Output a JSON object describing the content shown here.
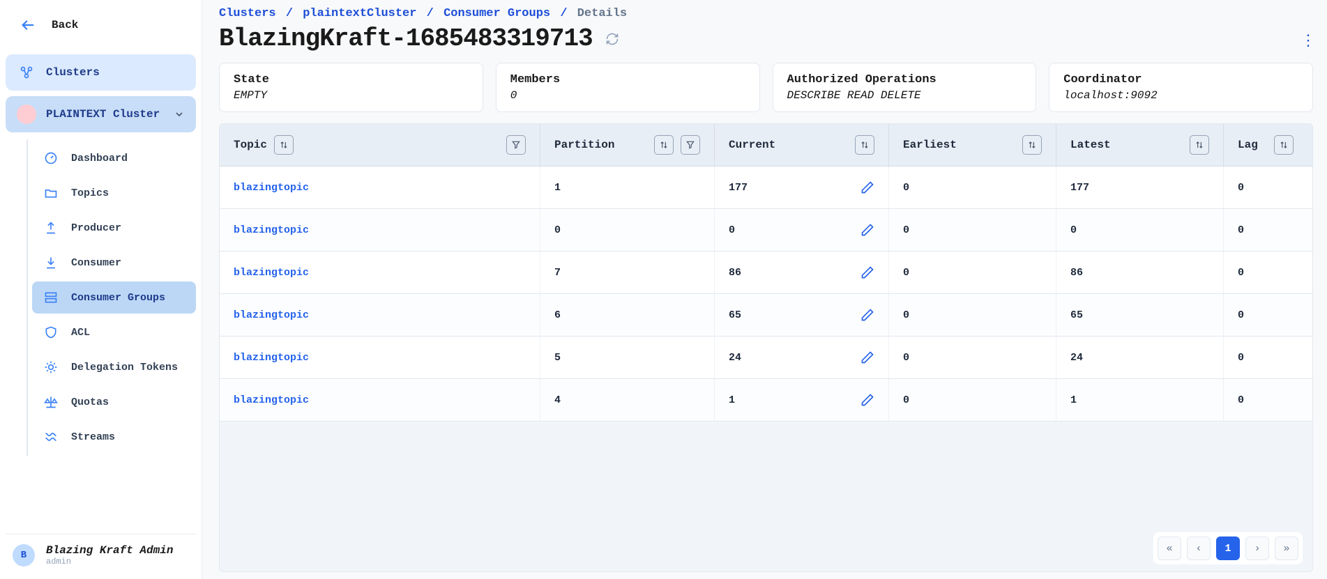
{
  "sidebar": {
    "back": "Back",
    "clusters": "Clusters",
    "current_cluster": "PLAINTEXT Cluster",
    "items": [
      {
        "label": "Dashboard"
      },
      {
        "label": "Topics"
      },
      {
        "label": "Producer"
      },
      {
        "label": "Consumer"
      },
      {
        "label": "Consumer Groups"
      },
      {
        "label": "ACL"
      },
      {
        "label": "Delegation Tokens"
      },
      {
        "label": "Quotas"
      },
      {
        "label": "Streams"
      }
    ],
    "user": {
      "initial": "B",
      "name": "Blazing Kraft Admin",
      "role": "admin"
    }
  },
  "breadcrumb": {
    "parts": [
      "Clusters",
      "plaintextCluster",
      "Consumer Groups",
      "Details"
    ]
  },
  "page_title": "BlazingKraft-1685483319713",
  "cards": [
    {
      "label": "State",
      "value": "EMPTY"
    },
    {
      "label": "Members",
      "value": "0"
    },
    {
      "label": "Authorized Operations",
      "value": "DESCRIBE READ DELETE"
    },
    {
      "label": "Coordinator",
      "value": "localhost:9092"
    }
  ],
  "table": {
    "headers": [
      "Topic",
      "Partition",
      "Current",
      "Earliest",
      "Latest",
      "Lag"
    ],
    "rows": [
      {
        "topic": "blazingtopic",
        "partition": "1",
        "current": "177",
        "earliest": "0",
        "latest": "177",
        "lag": "0"
      },
      {
        "topic": "blazingtopic",
        "partition": "0",
        "current": "0",
        "earliest": "0",
        "latest": "0",
        "lag": "0"
      },
      {
        "topic": "blazingtopic",
        "partition": "7",
        "current": "86",
        "earliest": "0",
        "latest": "86",
        "lag": "0"
      },
      {
        "topic": "blazingtopic",
        "partition": "6",
        "current": "65",
        "earliest": "0",
        "latest": "65",
        "lag": "0"
      },
      {
        "topic": "blazingtopic",
        "partition": "5",
        "current": "24",
        "earliest": "0",
        "latest": "24",
        "lag": "0"
      },
      {
        "topic": "blazingtopic",
        "partition": "4",
        "current": "1",
        "earliest": "0",
        "latest": "1",
        "lag": "0"
      }
    ]
  },
  "pager": {
    "current": "1"
  }
}
